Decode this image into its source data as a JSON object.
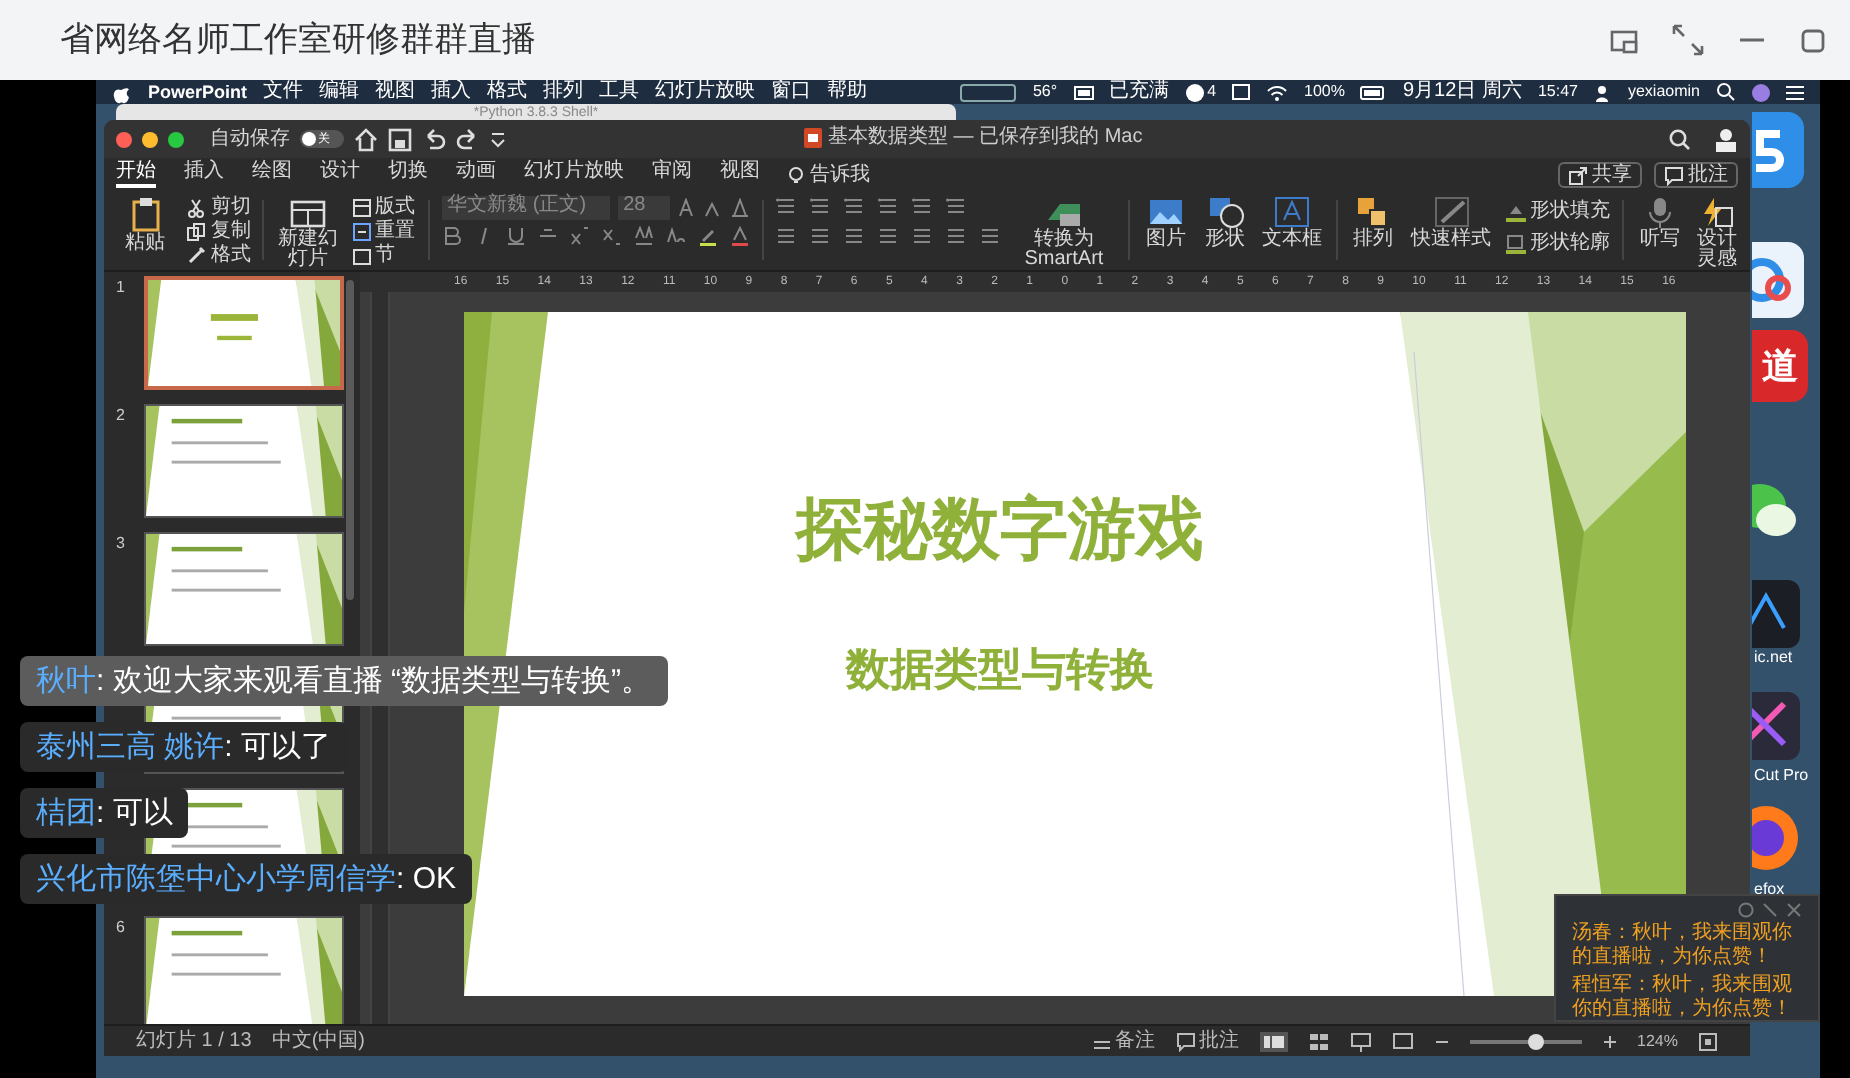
{
  "window": {
    "title": "省网络名师工作室研修群群直播"
  },
  "mac_menu_bar": {
    "app_name": "PowerPoint",
    "menus": [
      "文件",
      "编辑",
      "视图",
      "插入",
      "格式",
      "排列",
      "工具",
      "幻灯片放映",
      "窗口",
      "帮助"
    ],
    "temperature": "56°",
    "battery_status": "已充满",
    "notification_count": "4",
    "battery_percent": "100%",
    "date": "9月12日 周六",
    "time": "15:47",
    "user": "yexiaomin"
  },
  "background_window": {
    "title": "*Python 3.8.3 Shell*"
  },
  "desktop": {
    "icon_glyph": "道",
    "labels": [
      "ic.net",
      "Cut Pro",
      "efox"
    ]
  },
  "powerpoint": {
    "autosave_label": "自动保存",
    "autosave_on": false,
    "autosave_toggle_text": "关",
    "document_title": "基本数据类型 — 已保存到我的 Mac",
    "tabs": [
      {
        "label": "开始",
        "selected": true
      },
      {
        "label": "插入",
        "selected": false
      },
      {
        "label": "绘图",
        "selected": false
      },
      {
        "label": "设计",
        "selected": false
      },
      {
        "label": "切换",
        "selected": false
      },
      {
        "label": "动画",
        "selected": false
      },
      {
        "label": "幻灯片放映",
        "selected": false
      },
      {
        "label": "审阅",
        "selected": false
      },
      {
        "label": "视图",
        "selected": false
      }
    ],
    "tell_me": "告诉我",
    "share_button": "共享",
    "comments_button": "批注",
    "ribbon": {
      "paste": "粘贴",
      "cut": "剪切",
      "copy": "复制",
      "format_painter": "格式",
      "new_slide": "新建幻灯片",
      "layout": "版式",
      "reset": "重置",
      "section": "节",
      "font": "华文新魏 (正文)",
      "font_size": "28",
      "convert_smartart": "转换为 SmartArt",
      "picture": "图片",
      "shapes": "形状",
      "text_box": "文本框",
      "arrange": "排列",
      "quick_styles": "快速样式",
      "shape_fill": "形状填充",
      "shape_outline": "形状轮廓",
      "dictate": "听写",
      "design_ideas": "设计灵感"
    },
    "ruler_labels": [
      "16",
      "15",
      "14",
      "13",
      "12",
      "11",
      "10",
      "9",
      "8",
      "7",
      "6",
      "5",
      "4",
      "3",
      "2",
      "1",
      "0",
      "1",
      "2",
      "3",
      "4",
      "5",
      "6",
      "7",
      "8",
      "9",
      "10",
      "11",
      "12",
      "13",
      "14",
      "15",
      "16"
    ],
    "thumbnails": [
      {
        "number": "1",
        "selected": true
      },
      {
        "number": "2",
        "selected": false
      },
      {
        "number": "3",
        "selected": false
      },
      {
        "selected": false
      },
      {
        "selected": false
      },
      {
        "number": "6",
        "selected": false
      }
    ],
    "slide": {
      "title": "探秘数字游戏",
      "subtitle": "数据类型与转换"
    },
    "status_bar": {
      "slide_counter": "幻灯片 1 / 13",
      "language": "中文(中国)",
      "notes": "备注",
      "comments": "批注",
      "zoom": "124%",
      "zoom_slider": {
        "level": 0.6
      }
    }
  },
  "chat": [
    {
      "name": "秋叶",
      "message": ": 欢迎大家来观看直播 “数据类型与转换”。",
      "highlighted": true
    },
    {
      "name": "泰州三高 姚许",
      "message": ": 可以了",
      "highlighted": false
    },
    {
      "name": "桔团",
      "message": ": 可以",
      "highlighted": false
    },
    {
      "name": "兴化市陈堡中心小学周信学",
      "message": ": OK",
      "highlighted": false
    }
  ],
  "notification": {
    "messages": [
      "汤春：秋叶，我来围观你的直播啦，为你点赞！",
      "程恒军：秋叶，我来围观你的直播啦，为你点赞！"
    ]
  }
}
